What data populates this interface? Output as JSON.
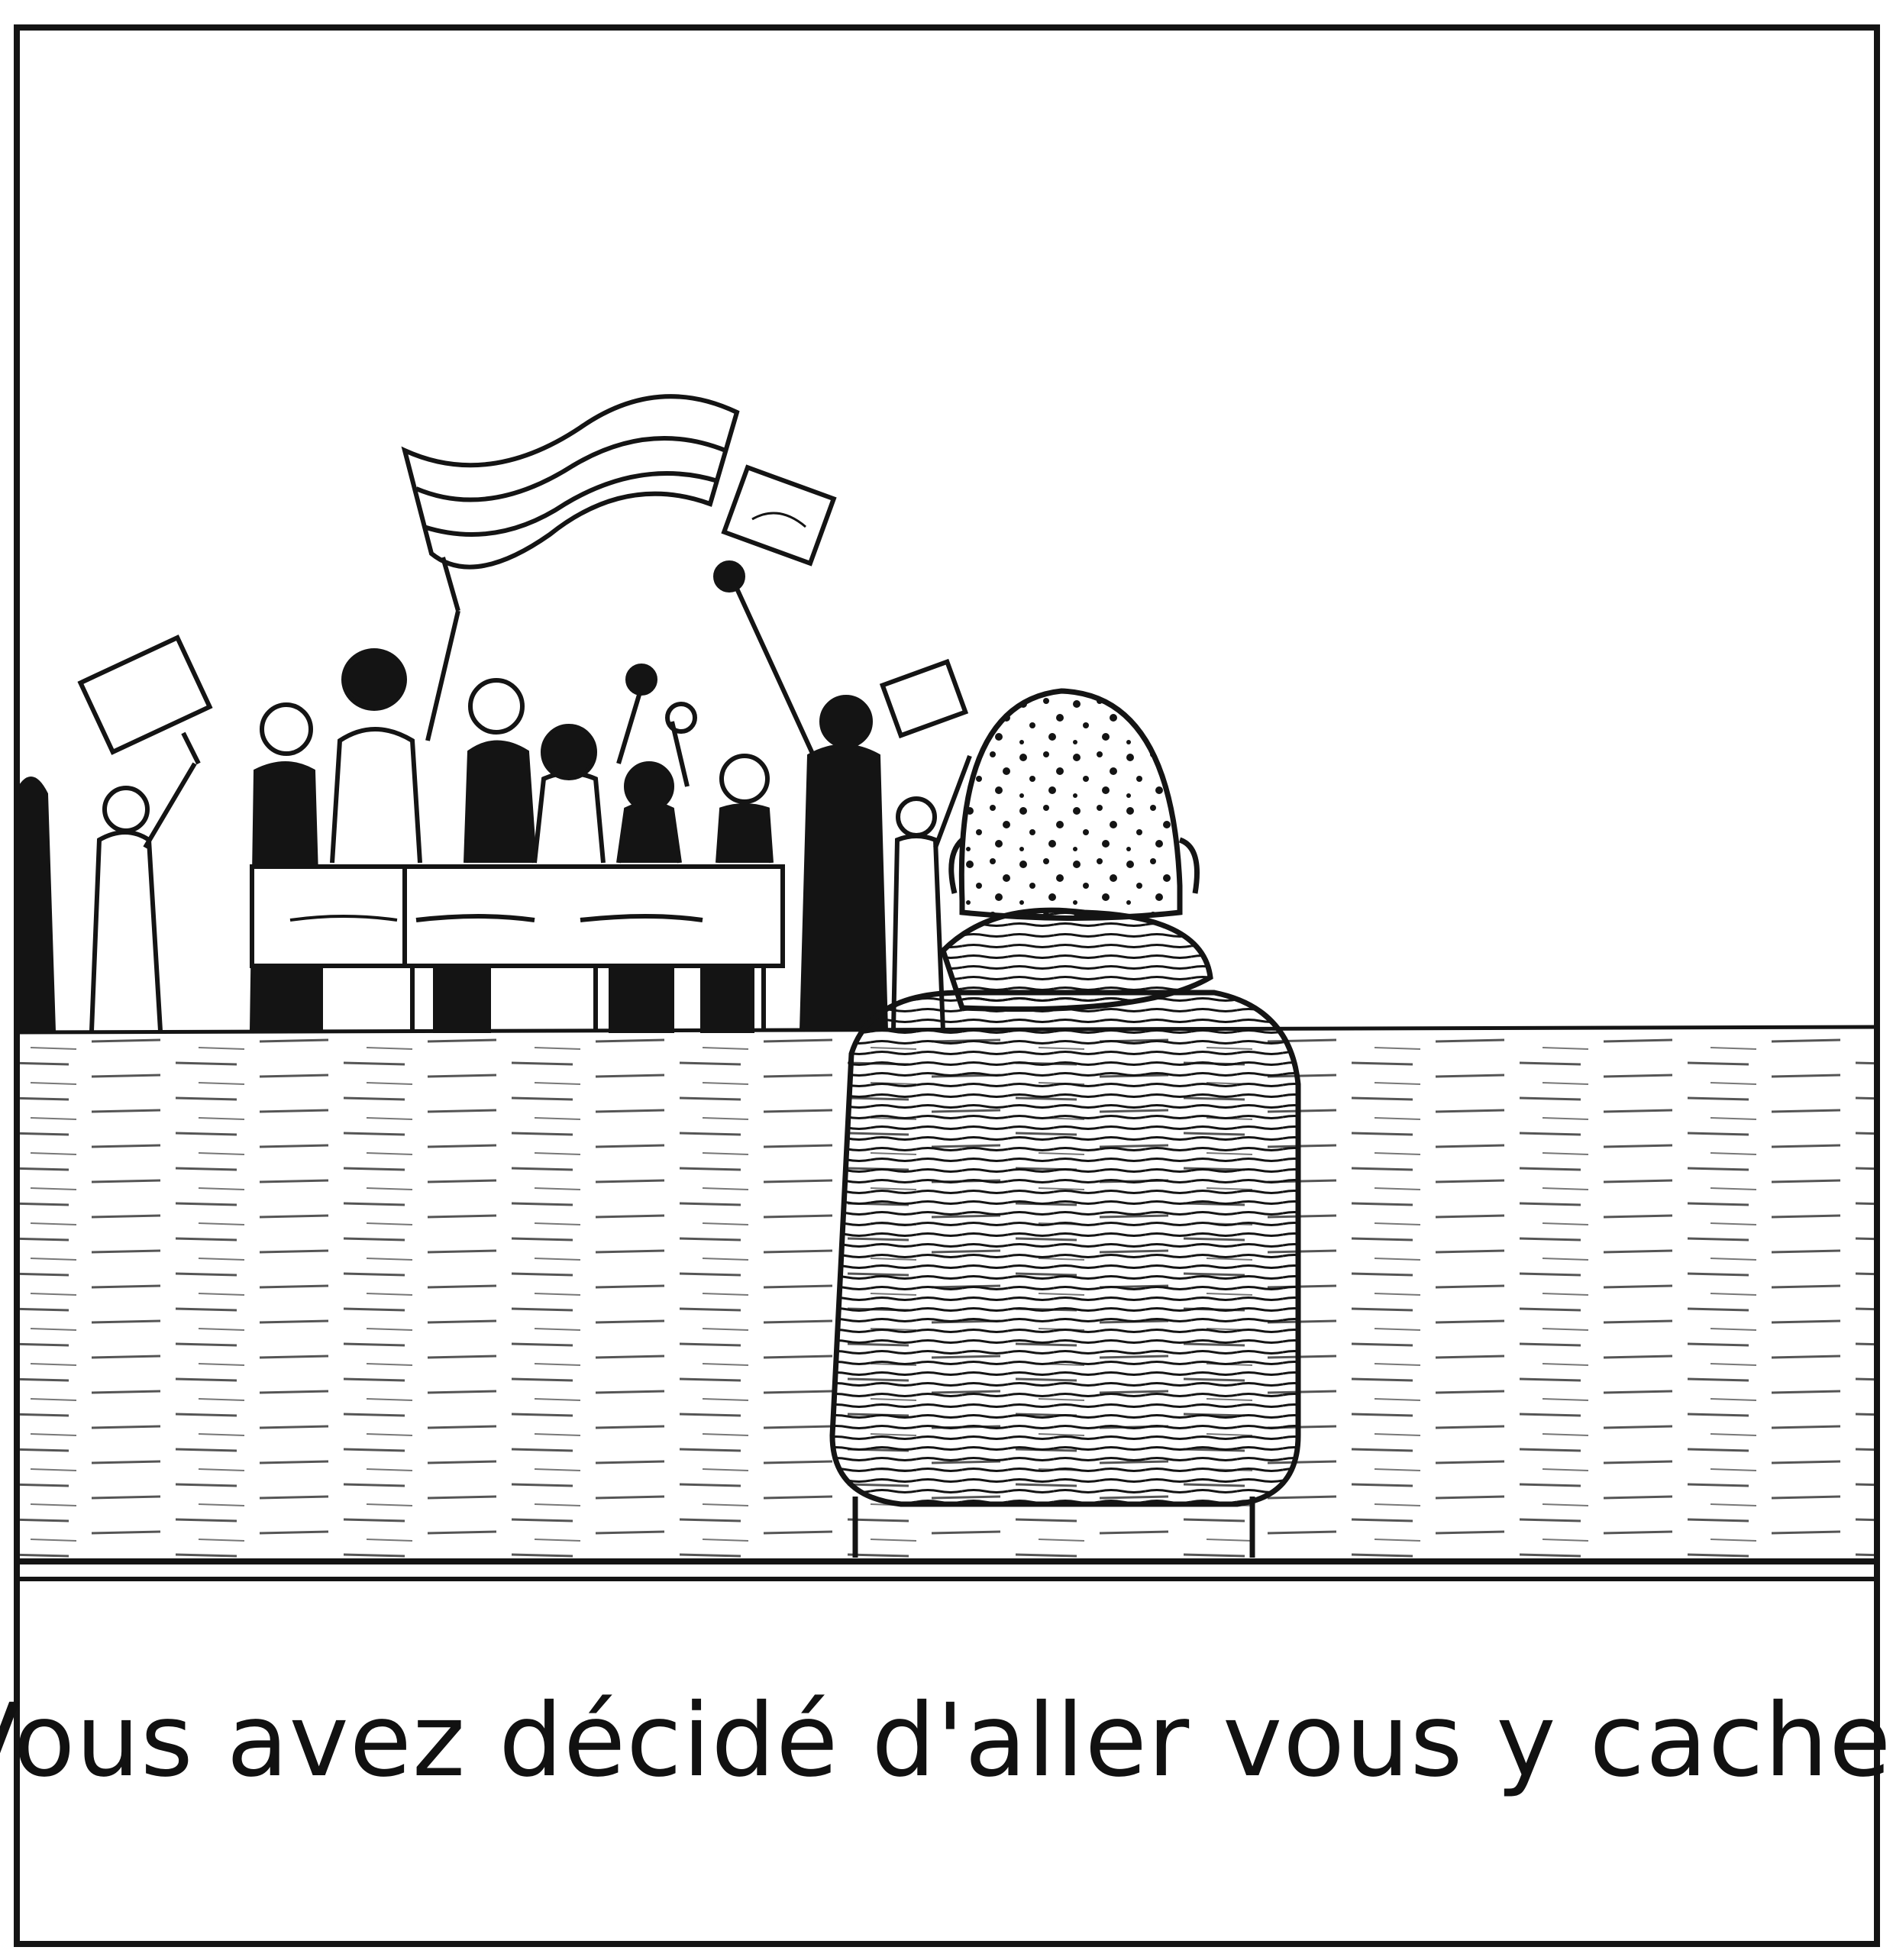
{
  "caption": {
    "text": "Vous avez décidé d'aller vous y cacher."
  },
  "colors": {
    "ink": "#141414",
    "paper": "#ffffff"
  }
}
